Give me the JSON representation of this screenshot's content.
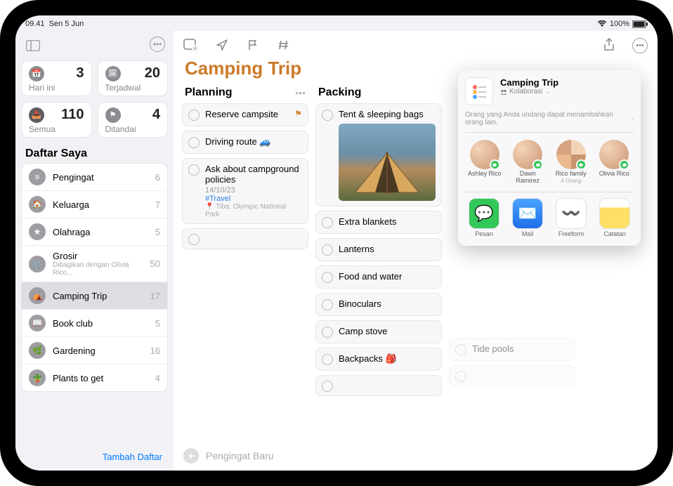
{
  "status": {
    "time": "09.41",
    "date": "Sen 5 Jun",
    "battery": "100%"
  },
  "sidebar": {
    "cards": [
      {
        "label": "Hari ini",
        "count": "3"
      },
      {
        "label": "Terjadwal",
        "count": "20"
      },
      {
        "label": "Semua",
        "count": "110"
      },
      {
        "label": "Ditandai",
        "count": "4"
      }
    ],
    "section": "Daftar Saya",
    "lists": [
      {
        "name": "Pengingat",
        "count": "6",
        "color": "#9d9da3"
      },
      {
        "name": "Keluarga",
        "count": "7",
        "color": "#9d9da3"
      },
      {
        "name": "Olahraga",
        "count": "5",
        "color": "#9d9da3"
      },
      {
        "name": "Grosir",
        "sub": "Dibagikan dengan Olivia Rico...",
        "count": "50",
        "color": "#9d9da3"
      },
      {
        "name": "Camping Trip",
        "count": "17",
        "color": "#9d9da3",
        "selected": true
      },
      {
        "name": "Book club",
        "count": "5",
        "color": "#9d9da3"
      },
      {
        "name": "Gardening",
        "count": "16",
        "color": "#9d9da3"
      },
      {
        "name": "Plants to get",
        "count": "4",
        "color": "#9d9da3"
      }
    ],
    "add": "Tambah Daftar"
  },
  "main": {
    "title": "Camping Trip",
    "new_reminder": "Pengingat Baru",
    "columns": [
      {
        "title": "Planning",
        "items": [
          {
            "text": "Reserve campsite",
            "flag": true
          },
          {
            "text": "Driving route 🚙"
          },
          {
            "text": "Ask about campground policies",
            "date": "14/10/23",
            "tag": "#Travel",
            "loc": "Tiba: Olympic National Park"
          }
        ]
      },
      {
        "title": "Packing",
        "items": [
          {
            "text": "Tent & sleeping bags",
            "image": true
          },
          {
            "text": "Extra blankets"
          },
          {
            "text": "Lanterns"
          },
          {
            "text": "Food and water"
          },
          {
            "text": "Binoculars"
          },
          {
            "text": "Camp stove"
          },
          {
            "text": "Backpacks 🎒"
          }
        ]
      },
      {
        "title": "",
        "items": [
          {
            "text": "Tide pools"
          }
        ]
      }
    ]
  },
  "share": {
    "title": "Camping Trip",
    "subtitle": "Kolaborasi",
    "note": "Orang yang Anda undang dapat menambahkan orang lain.",
    "contacts": [
      {
        "name": "Ashley Rico"
      },
      {
        "name": "Dawn Ramirez"
      },
      {
        "name": "Rico family",
        "sub": "4 Orang",
        "fam": true
      },
      {
        "name": "Olivia Rico"
      }
    ],
    "apps": [
      {
        "label": "Pesan",
        "bg": "#34c759",
        "glyph": "💬"
      },
      {
        "label": "Mail",
        "bg": "linear-gradient(#4aa3ff,#1e6fe8)",
        "glyph": "✉️"
      },
      {
        "label": "Freeform",
        "bg": "#fff",
        "glyph": "〰️"
      },
      {
        "label": "Catatan",
        "bg": "linear-gradient(#fff 0 30%,#ffe066 30% 100%)",
        "glyph": ""
      }
    ]
  }
}
